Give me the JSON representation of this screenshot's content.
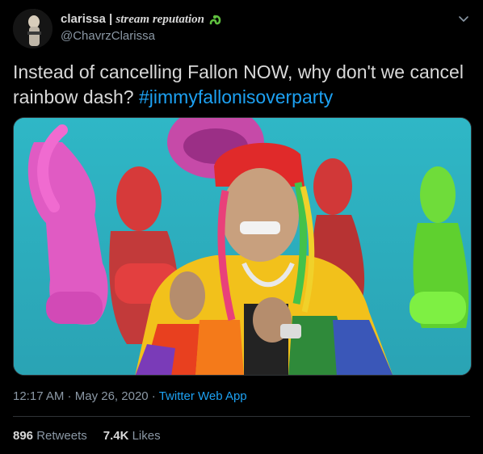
{
  "tweet": {
    "display_name_plain": "clarissa | ",
    "display_name_fancy": "stream reputation",
    "handle": "@ChavrzClarissa",
    "text_plain": "Instead of cancelling Fallon NOW, why don't we cancel rainbow dash? ",
    "hashtag": "#jimmyfallonisoverparty",
    "time": "12:17 AM",
    "separator": " · ",
    "date": "May 26, 2020",
    "source": "Twitter Web App",
    "retweets_count": "896",
    "retweets_label": "Retweets",
    "likes_count": "7.4K",
    "likes_label": "Likes"
  },
  "icons": {
    "name_icon": "snake-emoji-icon",
    "menu": "chevron-down-icon"
  },
  "colors": {
    "background": "#000000",
    "text": "#d9d9d9",
    "secondary": "#8b98a5",
    "accent": "#1da1f2",
    "divider": "#2f3336"
  }
}
